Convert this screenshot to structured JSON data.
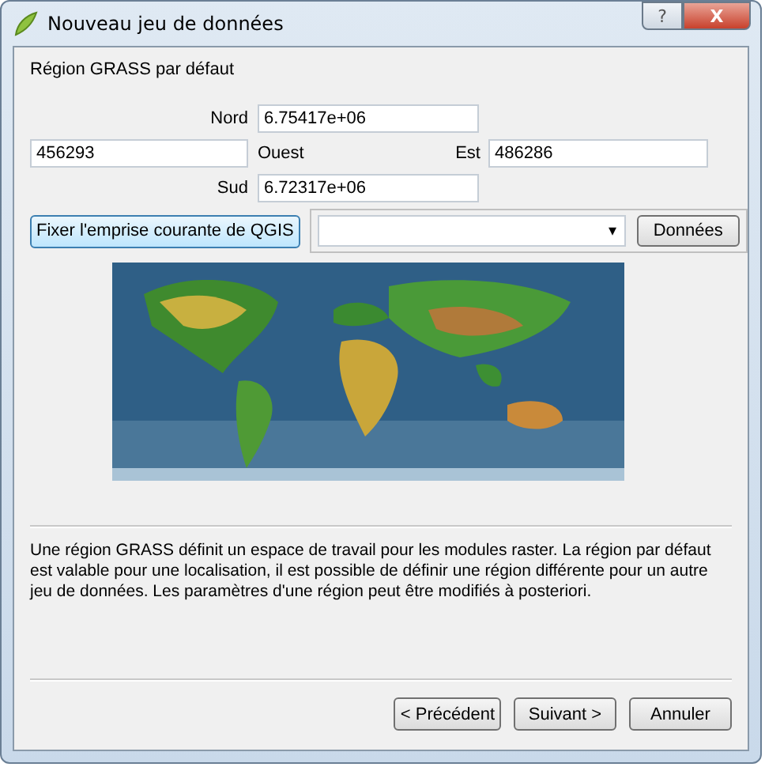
{
  "window": {
    "title": "Nouveau jeu de données",
    "title_buttons": [
      "?",
      "X"
    ]
  },
  "section_title": "Région GRASS par défaut",
  "extent": {
    "north": {
      "label": "Nord",
      "value": "6.75417e+06"
    },
    "west": {
      "label": "Ouest",
      "value": "456293"
    },
    "east": {
      "label": "Est",
      "value": "486286"
    },
    "south": {
      "label": "Sud",
      "value": "6.72317e+06"
    }
  },
  "set_extent_button": "Fixer l'emprise courante de QGIS",
  "combo": {
    "arrow": "▾"
  },
  "data_button": "Données",
  "description": "Une région GRASS définit un espace de travail pour les modules raster. La région par défaut est valable pour une localisation, il est possible de définir une région différente pour un autre jeu de données. Les paramètres d'une région peut être modifiés à posteriori.",
  "buttons": [
    {
      "label": "< Précédent",
      "disabled": false
    },
    {
      "label": "Suivant >",
      "disabled": false
    },
    {
      "label": "Annuler",
      "disabled": false
    }
  ]
}
